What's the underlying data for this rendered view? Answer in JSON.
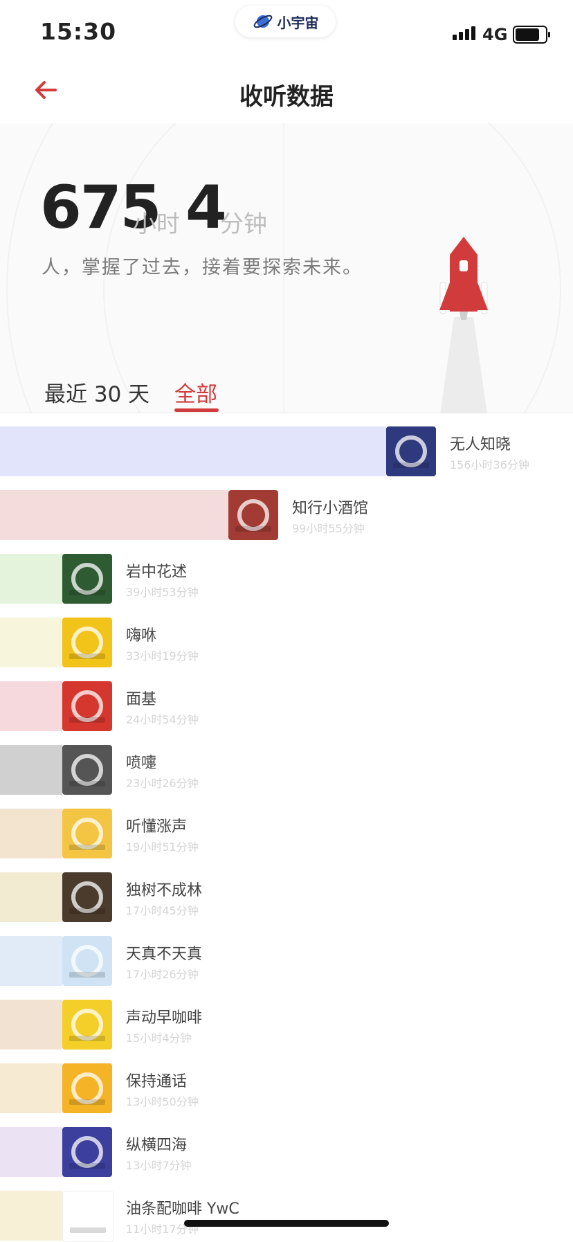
{
  "status_bar": {
    "time": "15:30",
    "app_pill_label": "小宇宙",
    "network": "4G",
    "battery_level_pct": 85
  },
  "nav": {
    "title": "收听数据",
    "back_icon": "arrow-left-icon"
  },
  "summary": {
    "hours_value": "675",
    "hours_unit": "小时",
    "minutes_value": "4",
    "minutes_unit": "分钟",
    "slogan": "人，掌握了过去，接着要探索未来。"
  },
  "tabs": [
    {
      "label": "最近 30 天",
      "active": false
    },
    {
      "label": "全部",
      "active": true
    }
  ],
  "podcasts": [
    {
      "name": "无人知晓",
      "duration": "156小时36分钟",
      "minutes": 9396,
      "bar_color": "#e1e4fa",
      "cover_color": "#2f3a7e"
    },
    {
      "name": "知行小酒馆",
      "duration": "99小时55分钟",
      "minutes": 5995,
      "bar_color": "#f5dcdc",
      "cover_color": "#a23b33"
    },
    {
      "name": "岩中花述",
      "duration": "39小时53分钟",
      "minutes": 2393,
      "bar_color": "#e3f3dc",
      "cover_color": "#2f5b32"
    },
    {
      "name": "嗨咻",
      "duration": "33小时19分钟",
      "minutes": 1999,
      "bar_color": "#f7f6dc",
      "cover_color": "#f2c318"
    },
    {
      "name": "面基",
      "duration": "24小时54分钟",
      "minutes": 1494,
      "bar_color": "#f5d9dd",
      "cover_color": "#d5362e"
    },
    {
      "name": "喷嚏",
      "duration": "23小时26分钟",
      "minutes": 1406,
      "bar_color": "#d0d0d0",
      "cover_color": "#555555"
    },
    {
      "name": "听懂涨声",
      "duration": "19小时51分钟",
      "minutes": 1191,
      "bar_color": "#f2e4cf",
      "cover_color": "#f3c542"
    },
    {
      "name": "独树不成林",
      "duration": "17小时45分钟",
      "minutes": 1065,
      "bar_color": "#f3ead2",
      "cover_color": "#4a3b2c"
    },
    {
      "name": "天真不天真",
      "duration": "17小时26分钟",
      "minutes": 1046,
      "bar_color": "#e1ebf8",
      "cover_color": "#cfe3f4"
    },
    {
      "name": "声动早咖啡",
      "duration": "15小时4分钟",
      "minutes": 904,
      "bar_color": "#f2e2d2",
      "cover_color": "#f4cf2a"
    },
    {
      "name": "保持通话",
      "duration": "13小时50分钟",
      "minutes": 830,
      "bar_color": "#f7ead2",
      "cover_color": "#f5b326"
    },
    {
      "name": "纵横四海",
      "duration": "13小时7分钟",
      "minutes": 787,
      "bar_color": "#ebe2f4",
      "cover_color": "#3d3f9e"
    },
    {
      "name": "油条配咖啡 YwC",
      "duration": "11小时17分钟",
      "minutes": 677,
      "bar_color": "#f7f0d6",
      "cover_color": "#ffffff"
    }
  ]
}
